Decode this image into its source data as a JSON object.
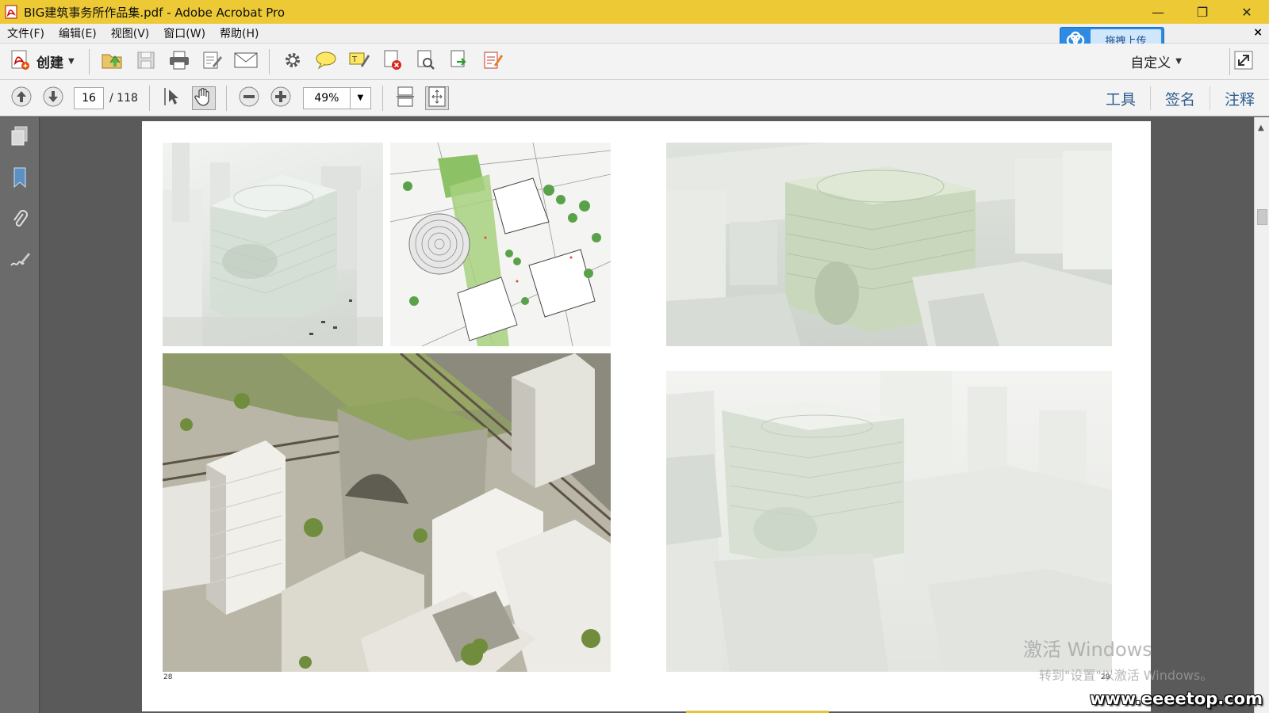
{
  "window": {
    "title": "BIG建筑事务所作品集.pdf - Adobe Acrobat Pro",
    "controls": {
      "minimize": "—",
      "restore": "❐",
      "close": "✕"
    }
  },
  "menu": {
    "items": [
      "文件(F)",
      "编辑(E)",
      "视图(V)",
      "窗口(W)",
      "帮助(H)"
    ],
    "close": "×"
  },
  "upload": {
    "label": "拖拽上传"
  },
  "toolbar": {
    "create_label": "创建",
    "customize_label": "自定义"
  },
  "navigation": {
    "current_page": "16",
    "total_pages": "/ 118",
    "zoom": "49%"
  },
  "right_tabs": [
    "工具",
    "签名",
    "注释"
  ],
  "document": {
    "left_page_number": "28",
    "right_page_number": "29"
  },
  "watermark": {
    "line1": "激活 Windows",
    "line2": "转到\"设置\"以激活 Windows。"
  },
  "site": "www.eeeetop.com",
  "colors": {
    "titlebar": "#ecc935",
    "accent_blue": "#2d8be3",
    "tab_text": "#2f5e8f"
  }
}
